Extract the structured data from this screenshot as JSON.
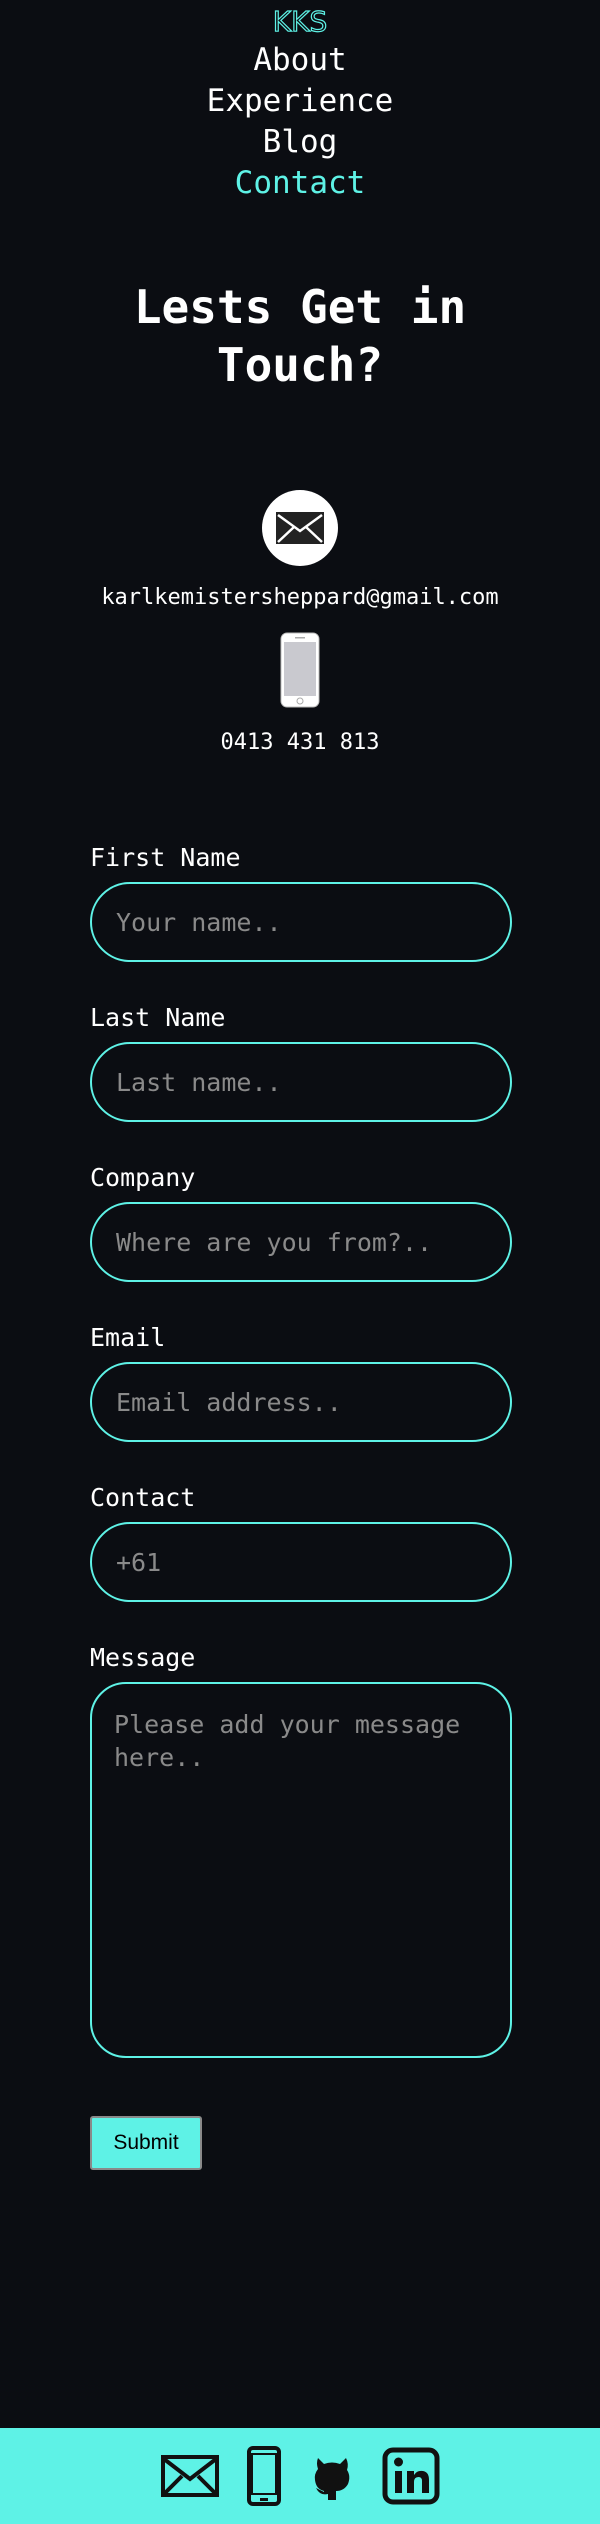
{
  "brand": {
    "logo_text": "KKS",
    "accent": "#5ef2e6",
    "background": "#0b0d12"
  },
  "nav": {
    "items": [
      {
        "label": "About"
      },
      {
        "label": "Experience"
      },
      {
        "label": "Blog"
      },
      {
        "label": "Contact",
        "active": true
      }
    ]
  },
  "heading": "Lests Get in Touch?",
  "contact": {
    "email_icon": "envelope-icon",
    "email": "karlkemistersheppard@gmail.com",
    "phone_icon": "smartphone-icon",
    "phone": "0413 431 813"
  },
  "form": {
    "first_name": {
      "label": "First Name",
      "placeholder": "Your name.."
    },
    "last_name": {
      "label": "Last Name",
      "placeholder": "Last name.."
    },
    "company": {
      "label": "Company",
      "placeholder": "Where are you from?.."
    },
    "email": {
      "label": "Email",
      "placeholder": "Email address.."
    },
    "contact": {
      "label": "Contact",
      "placeholder": "+61"
    },
    "message": {
      "label": "Message",
      "placeholder": "Please add your message here.."
    },
    "submit_label": "Submit"
  },
  "footer": {
    "icons": [
      "envelope-icon",
      "smartphone-icon",
      "github-icon",
      "linkedin-icon"
    ]
  }
}
